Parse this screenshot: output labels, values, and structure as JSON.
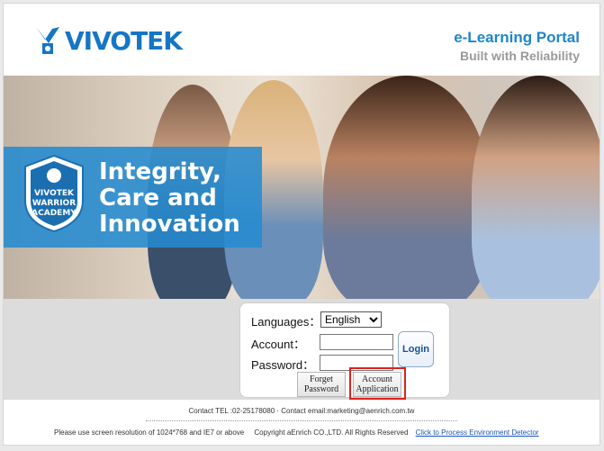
{
  "header": {
    "brand": "VIVOTEK",
    "portal_title": "e-Learning Portal",
    "portal_subtitle": "Built with Reliability"
  },
  "hero": {
    "banner_line1": "Integrity,",
    "banner_line2": "Care and",
    "banner_line3": "Innovation",
    "crest_line1": "VIVOTEK",
    "crest_line2": "WARRIOR",
    "crest_line3": "ACADEMY"
  },
  "login": {
    "languages_label": "Languages：",
    "language_selected": "English",
    "account_label": "Account：",
    "password_label": "Password：",
    "login_button": "Login",
    "forget_line1": "Forget",
    "forget_line2": "Password",
    "apply_line1": "Account",
    "apply_line2": "Application"
  },
  "footer": {
    "contact": "Contact TEL :02-25178080 · Contact email:marketing@aenrich.com.tw",
    "resolution_note": "Please use screen resolution of 1024*768 and IE7 or above",
    "copyright": "Copyright aEnrich CO.,LTD. All Rights Reserved",
    "detector_link": "Click to Process Environment Detector"
  },
  "colors": {
    "brand_blue": "#1576c6",
    "banner_blue": "#248bd0",
    "highlight_red": "#e0201d"
  }
}
